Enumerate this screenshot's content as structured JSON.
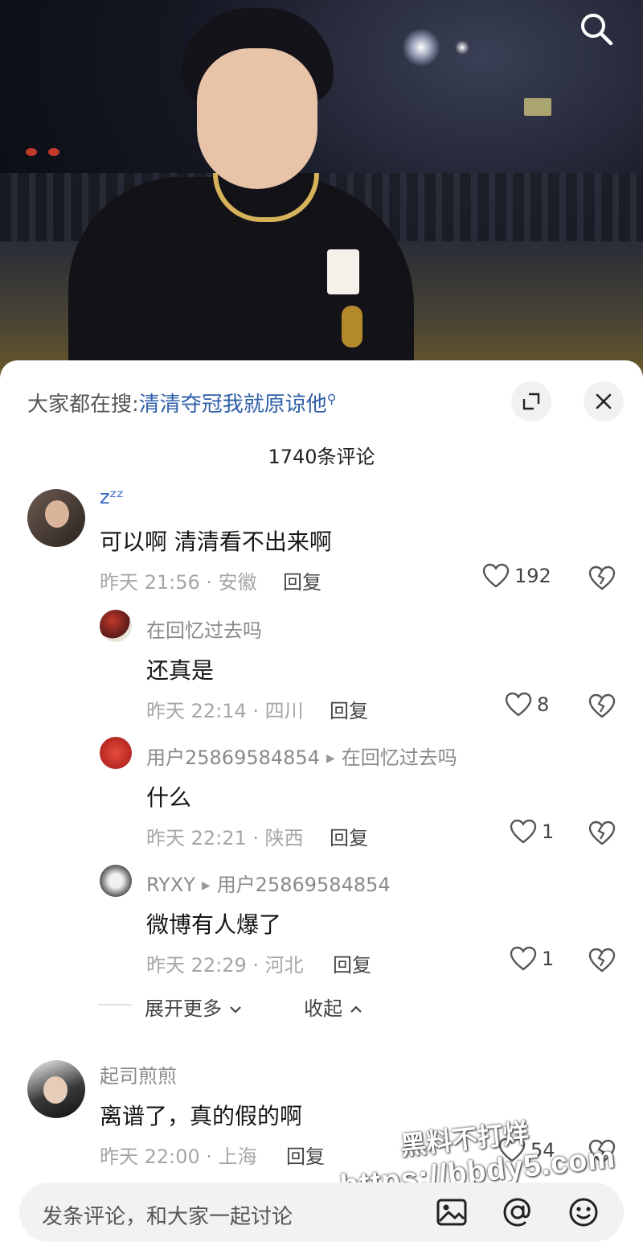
{
  "hot_search": {
    "prefix": "大家都在搜:",
    "query": "清清夺冠我就原谅他"
  },
  "comment_count": "1740条评论",
  "comments": [
    {
      "username": "zᶻᶻ",
      "text": "可以啊 清清看不出来啊",
      "meta": "昨天 21:56 · 安徽",
      "reply_label": "回复",
      "likes": "192",
      "replies": [
        {
          "username": "在回忆过去吗",
          "text": "还真是",
          "meta": "昨天 22:14 · 四川",
          "reply_label": "回复",
          "likes": "8"
        },
        {
          "username": "用户25869584854",
          "reply_to": "在回忆过去吗",
          "text": "什么",
          "meta": "昨天 22:21 · 陕西",
          "reply_label": "回复",
          "likes": "1"
        },
        {
          "username": "RYXY",
          "reply_to": "用户25869584854",
          "text": "微博有人爆了",
          "meta": "昨天 22:29 · 河北",
          "reply_label": "回复",
          "likes": "1"
        }
      ],
      "expand_label": "展开更多",
      "collapse_label": "收起"
    },
    {
      "username": "起司煎煎",
      "text": "离谱了，真的假的啊",
      "meta": "昨天 22:00 · 上海",
      "reply_label": "回复",
      "likes": "54"
    }
  ],
  "input": {
    "placeholder": "发条评论，和大家一起讨论"
  },
  "watermark": {
    "line1": "黑料不打烊",
    "line2": "https://bbdy5.com"
  },
  "icons": {
    "search": "search-icon",
    "fullscreen": "fullscreen-icon",
    "close": "close-icon",
    "like": "heart-outline-icon",
    "dislike": "broken-heart-icon",
    "image": "image-icon",
    "mention": "at-icon",
    "emoji": "emoji-icon"
  },
  "colors": {
    "link": "#2f5fa8",
    "meta_text": "#a6a6a6",
    "input_bg": "#f2f2f2"
  }
}
